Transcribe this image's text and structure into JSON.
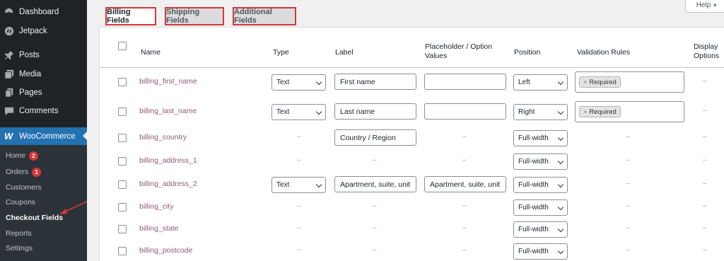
{
  "sidebar": {
    "items": [
      {
        "label": "Dashboard",
        "icon": "dashboard-icon"
      },
      {
        "label": "Jetpack",
        "icon": "jetpack-icon"
      },
      {
        "label": "Posts",
        "icon": "pin-icon"
      },
      {
        "label": "Media",
        "icon": "media-icon"
      },
      {
        "label": "Pages",
        "icon": "pages-icon"
      },
      {
        "label": "Comments",
        "icon": "comments-icon"
      }
    ],
    "woocommerce": {
      "label": "WooCommerce",
      "icon_glyph": "W"
    },
    "submenu": [
      {
        "label": "Home",
        "badge": "2"
      },
      {
        "label": "Orders",
        "badge": "1"
      },
      {
        "label": "Customers"
      },
      {
        "label": "Coupons"
      },
      {
        "label": "Checkout Fields"
      },
      {
        "label": "Reports"
      },
      {
        "label": "Settings"
      }
    ]
  },
  "tabs": [
    {
      "label": "Billing Fields",
      "active": true
    },
    {
      "label": "Shipping Fields",
      "active": false
    },
    {
      "label": "Additional Fields",
      "active": false
    }
  ],
  "help": {
    "label": "Help",
    "arrow": "▾"
  },
  "table": {
    "headers": {
      "name": "Name",
      "type": "Type",
      "label": "Label",
      "placeholder_1": "Placeholder / Option",
      "placeholder_2": "Values",
      "position": "Position",
      "validation": "Validation Rules",
      "display_1": "Display",
      "display_2": "Options"
    },
    "dash": "–",
    "rows": [
      {
        "name": "billing_first_name",
        "type": "Text",
        "label": "First name",
        "placeholder": "",
        "position": "Left",
        "validation": "Required",
        "display": "–"
      },
      {
        "name": "billing_last_name",
        "type": "Text",
        "label": "Last name",
        "placeholder": "",
        "position": "Right",
        "validation": "Required",
        "display": "–"
      },
      {
        "name": "billing_country",
        "type": "–",
        "label": "Country / Region",
        "placeholder": "–",
        "position": "Full-width",
        "validation": "–",
        "display": "–"
      },
      {
        "name": "billing_address_1",
        "type": "–",
        "label": "–",
        "placeholder": "–",
        "position": "Full-width",
        "validation": "–",
        "display": "–"
      },
      {
        "name": "billing_address_2",
        "type": "Text",
        "label": "Apartment, suite, unit",
        "placeholder": "Apartment, suite, unit",
        "position": "Full-width",
        "validation": "–",
        "display": "–"
      },
      {
        "name": "billing_city",
        "type": "–",
        "label": "–",
        "placeholder": "–",
        "position": "Full-width",
        "validation": "–",
        "display": "–"
      },
      {
        "name": "billing_state",
        "type": "–",
        "label": "–",
        "placeholder": "–",
        "position": "Full-width",
        "validation": "–",
        "display": "–"
      },
      {
        "name": "billing_postcode",
        "type": "–",
        "label": "–",
        "placeholder": "–",
        "position": "Full-width",
        "validation": "–",
        "display": "–"
      }
    ]
  },
  "colors": {
    "sidebar": "#1d2327",
    "accent": "#2271b1",
    "highlight": "#d63638",
    "field_name": "#8e5a72"
  }
}
